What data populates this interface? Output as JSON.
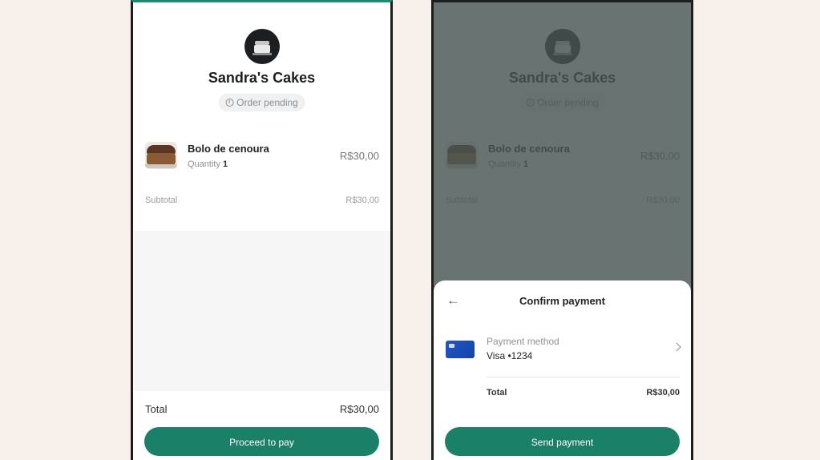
{
  "shop": {
    "name": "Sandra's Cakes",
    "status": "Order pending"
  },
  "order": {
    "item_name": "Bolo de cenoura",
    "quantity_label": "Quantity",
    "quantity": "1",
    "item_price": "R$30,00",
    "subtotal_label": "Subtotal",
    "subtotal_value": "R$30,00",
    "total_label": "Total",
    "total_value": "R$30,00"
  },
  "left_screen": {
    "button_label": "Proceed to pay"
  },
  "payment_sheet": {
    "back_icon": "arrow-left-icon",
    "title": "Confirm payment",
    "method_label": "Payment method",
    "method_value": "Visa •1234",
    "total_label": "Total",
    "total_value": "R$30,00",
    "button_label": "Send payment"
  },
  "colors": {
    "accent": "#1b8068",
    "background": "#f8f1eb",
    "overlay": "#485452",
    "card": "#1e56c8"
  }
}
